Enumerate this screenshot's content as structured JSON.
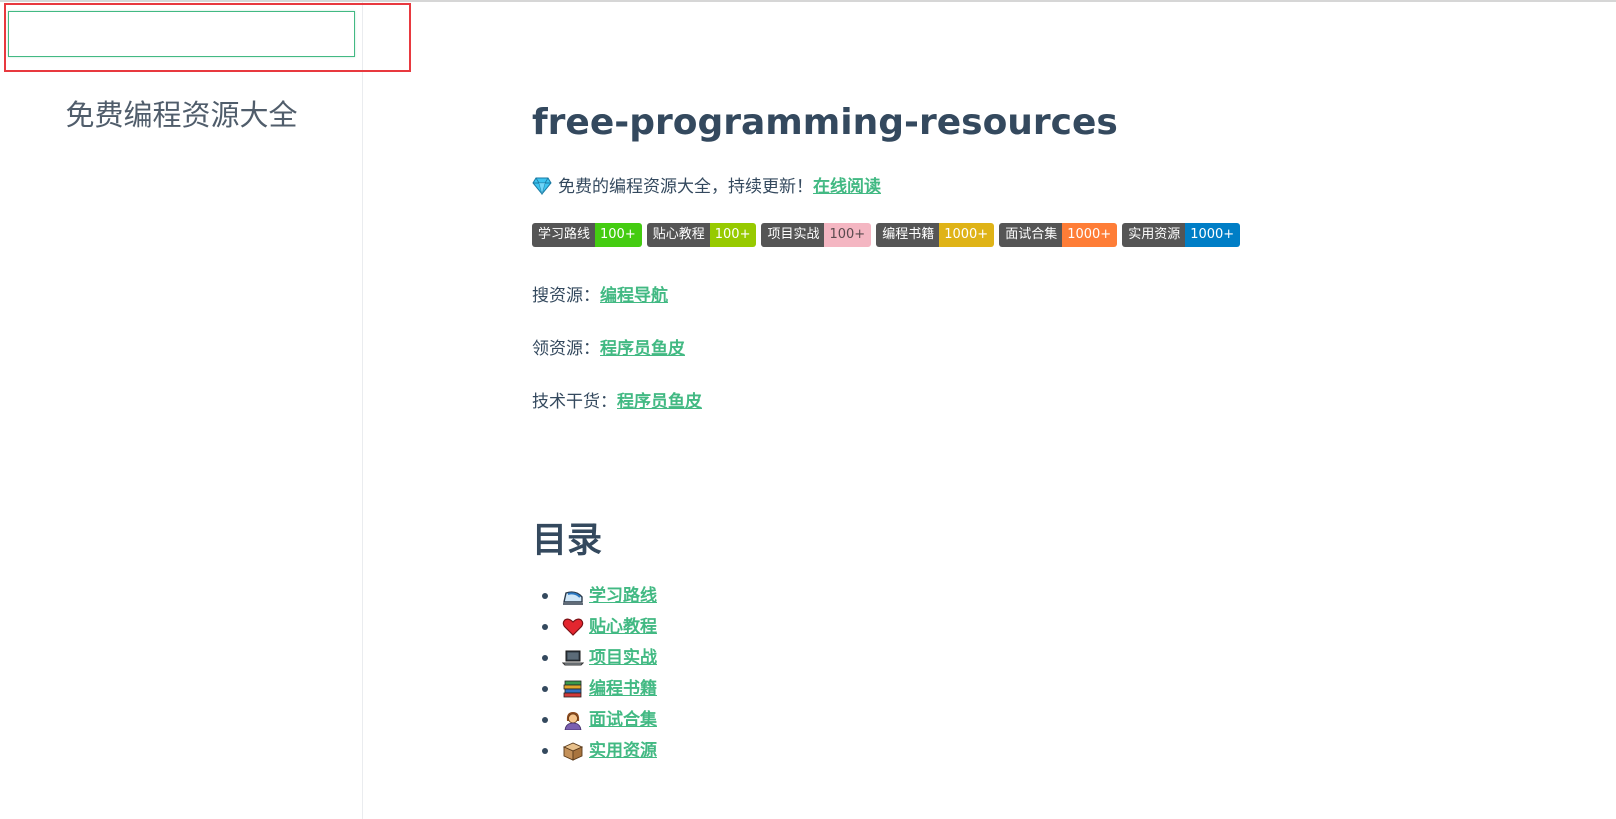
{
  "sidebar": {
    "search": {
      "placeholder": "",
      "value": ""
    },
    "site_name": "免费编程资源大全"
  },
  "main": {
    "title": "free-programming-resources",
    "intro": {
      "icon": "gem-icon",
      "text": "免费的编程资源大全，持续更新！",
      "link_label": "在线阅读"
    },
    "badges": [
      {
        "label": "学习路线",
        "value": "100+",
        "color": "#4c1"
      },
      {
        "label": "贴心教程",
        "value": "100+",
        "color": "#97ca00"
      },
      {
        "label": "项目实战",
        "value": "100+",
        "color": "#f4b6c2"
      },
      {
        "label": "编程书籍",
        "value": "1000+",
        "color": "#dfb317"
      },
      {
        "label": "面试合集",
        "value": "1000+",
        "color": "#fe7d37"
      },
      {
        "label": "实用资源",
        "value": "1000+",
        "color": "#007ec6"
      }
    ],
    "lines": [
      {
        "label": "搜资源：",
        "link": "编程导航"
      },
      {
        "label": "领资源：",
        "link": "程序员鱼皮"
      },
      {
        "label": "技术干货：",
        "link": "程序员鱼皮"
      }
    ],
    "toc": {
      "title": "目录",
      "items": [
        {
          "icon": "train-icon",
          "label": "学习路线"
        },
        {
          "icon": "heart-icon",
          "label": "贴心教程"
        },
        {
          "icon": "laptop-icon",
          "label": "项目实战"
        },
        {
          "icon": "books-icon",
          "label": "编程书籍"
        },
        {
          "icon": "woman-icon",
          "label": "面试合集"
        },
        {
          "icon": "package-icon",
          "label": "实用资源"
        }
      ]
    }
  },
  "colors": {
    "accent": "#42b983",
    "text": "#34495e",
    "highlight": "#e8393f"
  }
}
